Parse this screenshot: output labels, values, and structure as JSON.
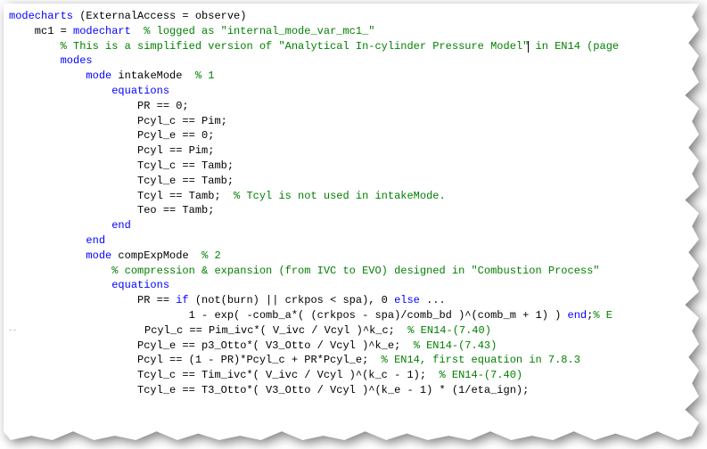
{
  "code": {
    "l1_kw": "modecharts",
    "l1_txt": " (ExternalAccess = observe)",
    "l2_ind": "    mc1 = ",
    "l2_kw": "modechart",
    "l2_cm": "  % logged as \"internal_mode_var_mc1_\"",
    "l3_ind": "        ",
    "l3_cm": "% This is a simplified version of \"Analytical In-cylinder Pressure Model\"",
    "l3_cm2": " in EN14 (page",
    "l4_ind": "        ",
    "l4_kw": "modes",
    "l5_ind": "            ",
    "l5_kw": "mode",
    "l5_txt": " intakeMode  ",
    "l5_cm": "% 1",
    "l6_ind": "                ",
    "l6_kw": "equations",
    "l7": "                    PR == 0;",
    "l8": "                    Pcyl_c == Pim;",
    "l9": "                    Pcyl_e == 0;",
    "l10": "                    Pcyl == Pim;",
    "l11": "                    Tcyl_c == Tamb;",
    "l12": "                    Tcyl_e == Tamb;",
    "l13a": "                    Tcyl == Tamb;  ",
    "l13_cm": "% Tcyl is not used in intakeMode.",
    "l14": "                    Teo == Tamb;",
    "l15_ind": "                ",
    "l15_kw": "end",
    "l16_ind": "            ",
    "l16_kw": "end",
    "l17_ind": "            ",
    "l17_kw": "mode",
    "l17_txt": " compExpMode  ",
    "l17_cm": "% 2",
    "l18_ind": "                ",
    "l18_cm": "% compression & expansion (from IVC to EVO) designed in \"Combustion Process\"",
    "l19_ind": "                ",
    "l19_kw": "equations",
    "l20a": "                    PR == ",
    "l20_kw1": "if",
    "l20b": " (not(burn) || crkpos < spa), 0 ",
    "l20_kw2": "else",
    "l20c": " ...",
    "l21a": "                            1 - exp( -comb_a*( (crkpos - spa)/comb_bd )^(comb_m + 1) ) ",
    "l21_kw": "end",
    "l21b": ";",
    "l21_cm": "% E",
    "l22a": "                    Pcyl_c == Pim_ivc*( V_ivc / Vcyl )^k_c;  ",
    "l22_cm": "% EN14-(7.40)",
    "l23a": "                    Pcyl_e == p3_Otto*( V3_Otto / Vcyl )^k_e;  ",
    "l23_cm": "% EN14-(7.43)",
    "l24a": "                    Pcyl == (1 - PR)*Pcyl_c + PR*Pcyl_e;  ",
    "l24_cm": "% EN14, first equation in 7.8.3",
    "l25a": "                    Tcyl_c == Tim_ivc*( V_ivc / Vcyl )^(k_c - 1);  ",
    "l25_cm": "% EN14-(7.40)",
    "l26": "                    Tcyl_e == T3_Otto*( V3_Otto / Vcyl )^(k_e - 1) * (1/eta_ign);"
  }
}
